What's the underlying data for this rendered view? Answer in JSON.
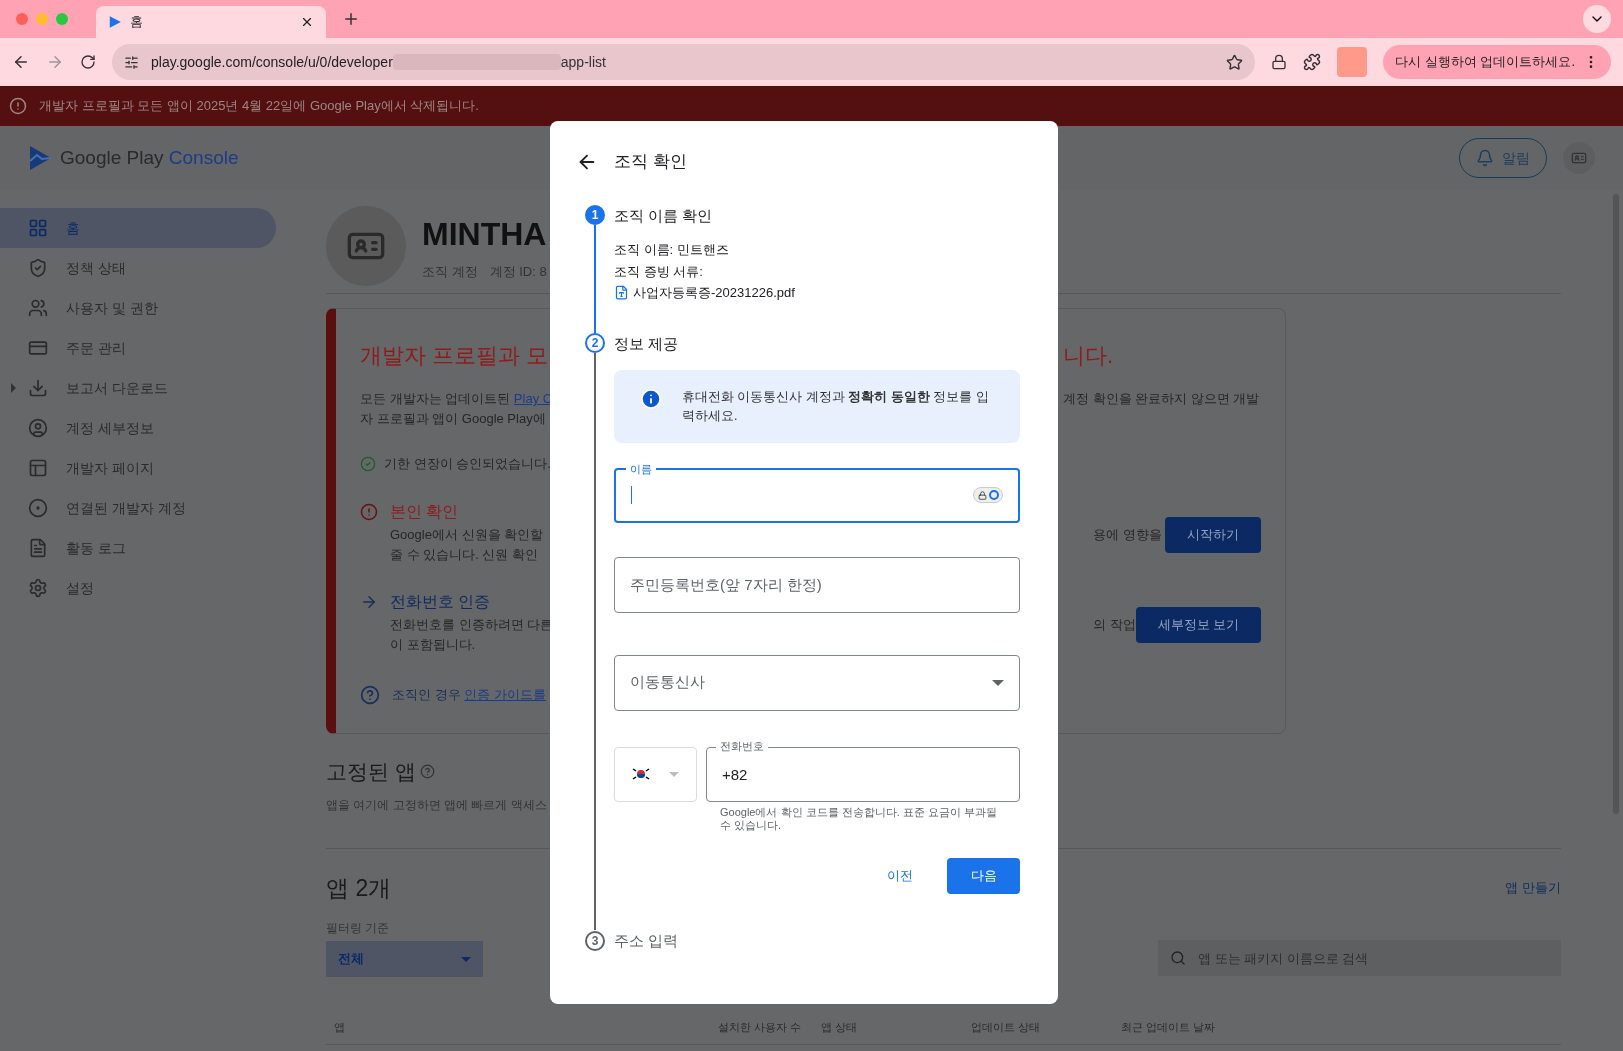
{
  "browser": {
    "tab": {
      "title": "홈"
    },
    "url_start": "play.google.com/console/u/0/developer",
    "url_end": "app-list",
    "update_button": "다시 실행하여 업데이트하세요."
  },
  "banner": {
    "text": "개발자 프로필과 모든 앱이 2025년 4월 22일에 Google Play에서 삭제됩니다."
  },
  "header": {
    "logo_main": "Google Play",
    "logo_accent": "Console",
    "notify_button": "알림"
  },
  "sidebar": {
    "items": [
      {
        "label": "홈",
        "selected": true,
        "kind": "link"
      },
      {
        "label": "정책 상태",
        "selected": false,
        "kind": "link"
      },
      {
        "label": "사용자 및 권한",
        "selected": false,
        "kind": "link"
      },
      {
        "label": "주문 관리",
        "selected": false,
        "kind": "link"
      },
      {
        "label": "보고서 다운로드",
        "selected": false,
        "kind": "group"
      },
      {
        "label": "계정 세부정보",
        "selected": false,
        "kind": "link"
      },
      {
        "label": "개발자 페이지",
        "selected": false,
        "kind": "link"
      },
      {
        "label": "연결된 개발자 계정",
        "selected": false,
        "kind": "link"
      },
      {
        "label": "활동 로그",
        "selected": false,
        "kind": "link"
      },
      {
        "label": "설정",
        "selected": false,
        "kind": "link"
      }
    ]
  },
  "profile": {
    "name": "MINTHA",
    "account_type": "조직 계정",
    "account_id": "계정 ID: 8"
  },
  "alert_card": {
    "title_left": "개발자 프로필과 모",
    "title_right": "니다.",
    "intro_left": "모든 개발자는 업데이트된 ",
    "intro_link": "Play C",
    "intro_right": "계정 확인을 완료하지 않으면 개발",
    "intro_line2": "자 프로필과 앱이 Google Play에",
    "extension": "기한 연장이 승인되었습니다.",
    "tasks": [
      {
        "kind": "alert",
        "title": "본인 확인",
        "lines": [
          "Google에서 신원을 확인할",
          "줄 수 있습니다. 신원 확인"
        ],
        "right_text": "용에 영향을",
        "button": "시작하기"
      },
      {
        "kind": "arrow",
        "title": "전화번호 인증",
        "lines": [
          "전화번호를 인증하려면 다른",
          "이 포함됩니다."
        ],
        "right_text": "의 작업",
        "button": "세부정보 보기"
      }
    ],
    "help_text": "조직인 경우 ",
    "help_link": "인증 가이드를"
  },
  "pinned": {
    "title": "고정된 앱",
    "description": "앱을 여기에 고정하면 앱에 빠르게 액세스"
  },
  "apps": {
    "title": "앱 2개",
    "create_link": "앱 만들기",
    "filter_label": "필터링 기준",
    "filter_value": "전체",
    "search": {
      "placeholder": "앱 또는 패키지 이름으로 검색"
    },
    "columns": [
      "앱",
      "설치한 사용자 수",
      "앱 상태",
      "업데이트 상태",
      "최근 업데이트 날짜"
    ]
  },
  "dialog": {
    "title": "조직 확인",
    "steps": [
      {
        "number": "1",
        "title": "조직 이름 확인",
        "kind": "done"
      },
      {
        "number": "2",
        "title": "정보 제공",
        "kind": "active"
      },
      {
        "number": "3",
        "title": "주소 입력",
        "kind": "pending"
      }
    ],
    "org_name": "조직 이름: 민트핸즈",
    "doc_label": "조직 증빙 서류:",
    "doc_file": "사업자등록증-20231226.pdf",
    "info": "휴대전화 이동통신사 계정과 **정확히 동일한** 정보를 입력하세요.",
    "name_field": {
      "label": "이름",
      "focused": true
    },
    "id_field": {
      "placeholder": "주민등록번호(앞 7자리 한정)"
    },
    "carrier_select": {
      "placeholder": "이동통신사"
    },
    "phone_field": {
      "label": "전화번호",
      "value": "+82"
    },
    "phone_hint": "Google에서 확인 코드를 전송합니다. 표준 요금이 부과될 수 있습니다.",
    "back_button": "이전",
    "next_button": "다음"
  }
}
